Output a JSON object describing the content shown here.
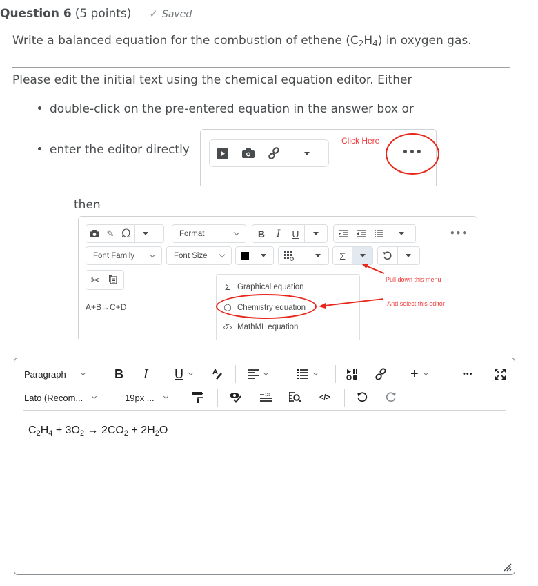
{
  "question": {
    "title": "Question 6",
    "points": "(5 points)",
    "status": "Saved",
    "prompt_pre": "Write a balanced equation for the combustion of ethene (C",
    "prompt_sub1": "2",
    "prompt_mid": "H",
    "prompt_sub2": "4",
    "prompt_post": ") in oxygen gas."
  },
  "instructions": {
    "intro": "Please edit the initial text using the chemical equation editor. Either",
    "bullets": [
      "double-click on the pre-entered equation in the answer box or",
      "enter the editor directly"
    ],
    "then": "then"
  },
  "mini_editor": {
    "icons": [
      "video-icon",
      "camera-icon",
      "link-icon",
      "dropdown-icon"
    ],
    "annotation": "Click Here",
    "more_label": "•••"
  },
  "legacy_editor": {
    "format_label": "Format",
    "font_family_label": "Font Family",
    "font_size_label": "Font Size",
    "bold": "B",
    "italic": "I",
    "underline": "U",
    "more_label": "•••",
    "sample_equation": "A+B→C+D",
    "menu_items": [
      {
        "icon": "Σ",
        "label": "Graphical equation"
      },
      {
        "icon": "⬡",
        "label": "Chemistry equation"
      },
      {
        "icon": "‹Σ›",
        "label": "MathML equation"
      }
    ],
    "annotation_pull": "Pull down this menu",
    "annotation_select": "And select this editor",
    "accent": "#e8261c"
  },
  "answer_editor": {
    "block_format": "Paragraph",
    "font_family": "Lato (Recom...",
    "font_size": "19px ...",
    "bold": "B",
    "italic": "I",
    "underline": "U",
    "more_label": "•••",
    "answer": {
      "parts": [
        {
          "t": "C"
        },
        {
          "s": "2"
        },
        {
          "t": "H"
        },
        {
          "s": "4"
        },
        {
          "t": " + 3O"
        },
        {
          "s": "2"
        },
        {
          "t": " → 2CO"
        },
        {
          "s": "2"
        },
        {
          "t": " + 2H"
        },
        {
          "s": "2"
        },
        {
          "t": "O"
        }
      ]
    }
  }
}
